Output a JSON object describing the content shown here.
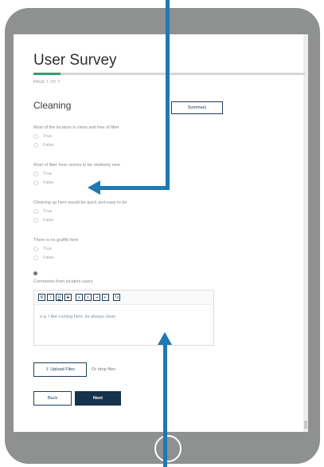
{
  "survey": {
    "title": "User Survey",
    "page_indicator": "PAGE 1 OF 7",
    "progress_fraction": 0.1,
    "section_title": "Cleaning",
    "summary_label": "Summary",
    "questions": [
      {
        "text": "Most of the location is clean and free of litter",
        "options": [
          "True",
          "False"
        ]
      },
      {
        "text": "Most of litter here seems to be relatively new",
        "options": [
          "True",
          "False"
        ]
      },
      {
        "text": "Cleaning up here would be quick and easy to do",
        "options": [
          "True",
          "False"
        ]
      },
      {
        "text": "There is no graffiti here",
        "options": [
          "True",
          "False"
        ]
      }
    ],
    "comments": {
      "label": "Comments from location users",
      "placeholder": "e.g. I like coming here, its always clean",
      "toolbar": [
        "B",
        "I",
        "U",
        "S",
        "≡",
        "≡",
        "⇥",
        "⇤",
        "Tx"
      ]
    },
    "upload_label": "⇪ Upload Files",
    "drop_text": "Or drop files",
    "back_label": "Back",
    "next_label": "Next"
  },
  "colors": {
    "tablet": "#8f9090",
    "accent_arrow": "#1f79b0",
    "progress": "#2aa36a",
    "primary_button": "#16324c"
  }
}
